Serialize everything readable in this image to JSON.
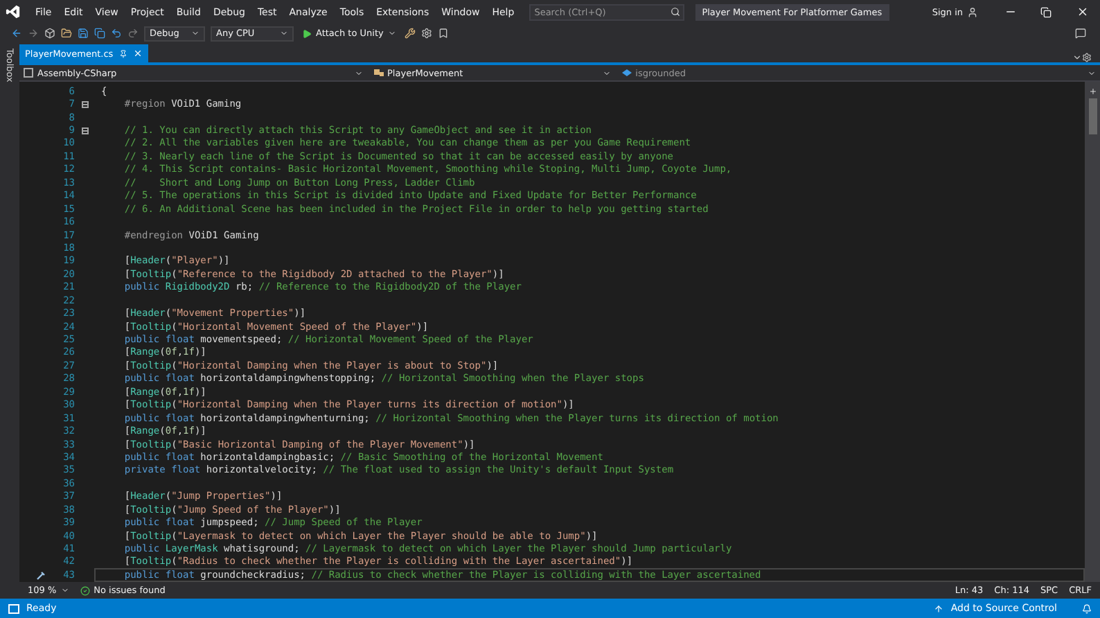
{
  "window": {
    "title": "Player Movement For Platformer Games",
    "sign_in": "Sign in"
  },
  "menu": [
    "File",
    "Edit",
    "View",
    "Project",
    "Build",
    "Debug",
    "Test",
    "Analyze",
    "Tools",
    "Extensions",
    "Window",
    "Help"
  ],
  "search": {
    "placeholder": "Search (Ctrl+Q)"
  },
  "toolbar": {
    "configuration": "Debug",
    "platform": "Any CPU",
    "run": "Attach to Unity"
  },
  "side_panel": {
    "label": "Toolbox"
  },
  "tabs": [
    {
      "label": "PlayerMovement.cs",
      "selected": true
    }
  ],
  "navigation": {
    "project": "Assembly-CSharp",
    "type": "PlayerMovement",
    "member": "isgrounded"
  },
  "editor": {
    "lines": [
      {
        "number": "6",
        "fold": false,
        "current": false,
        "tokens": [
          {
            "kind": "plain",
            "text": "{"
          }
        ]
      },
      {
        "number": "7",
        "fold": true,
        "current": false,
        "tokens": [
          {
            "kind": "directive",
            "text": "    #region"
          },
          {
            "kind": "plain",
            "text": " VOiD1 Gaming"
          }
        ]
      },
      {
        "number": "8",
        "fold": false,
        "current": false
      },
      {
        "number": "9",
        "fold": true,
        "current": false,
        "tokens": [
          {
            "kind": "comment",
            "text": "    // 1. You can directly attach this Script to any GameObject and see it in action"
          }
        ]
      },
      {
        "number": "10",
        "fold": false,
        "current": false,
        "tokens": [
          {
            "kind": "comment",
            "text": "    // 2. All the variables given here are tweakable, You can change them as per you Game Requirement"
          }
        ]
      },
      {
        "number": "11",
        "fold": false,
        "current": false,
        "tokens": [
          {
            "kind": "comment",
            "text": "    // 3. Nearly each line of the Script is Documented so that it can be accessed easily by anyone"
          }
        ]
      },
      {
        "number": "12",
        "fold": false,
        "current": false,
        "tokens": [
          {
            "kind": "comment",
            "text": "    // 4. This Script contains- Basic Horizontal Movement, Smoothing while Stoping, Multi Jump, Coyote Jump,"
          }
        ]
      },
      {
        "number": "13",
        "fold": false,
        "current": false,
        "tokens": [
          {
            "kind": "comment",
            "text": "    //    Short and Long Jump on Button Long Press, Ladder Climb"
          }
        ]
      },
      {
        "number": "14",
        "fold": false,
        "current": false,
        "tokens": [
          {
            "kind": "comment",
            "text": "    // 5. The operations in this Script is divided into Update and Fixed Update for Better Performance"
          }
        ]
      },
      {
        "number": "15",
        "fold": false,
        "current": false,
        "tokens": [
          {
            "kind": "comment",
            "text": "    // 6. An Additional Scene has been included in the Project File in order to help you getting started"
          }
        ]
      },
      {
        "number": "16",
        "fold": false,
        "current": false
      },
      {
        "number": "17",
        "fold": false,
        "current": false,
        "tokens": [
          {
            "kind": "directive",
            "text": "    #endregion"
          },
          {
            "kind": "plain",
            "text": " VOiD1 Gaming"
          }
        ]
      },
      {
        "number": "18",
        "fold": false,
        "current": false
      },
      {
        "number": "19",
        "fold": false,
        "current": false,
        "tokens": [
          {
            "kind": "plain",
            "text": "    ["
          },
          {
            "kind": "type",
            "text": "Header"
          },
          {
            "kind": "plain",
            "text": "("
          },
          {
            "kind": "string",
            "text": "\"Player\""
          },
          {
            "kind": "plain",
            "text": ")]"
          }
        ]
      },
      {
        "number": "20",
        "fold": false,
        "current": false,
        "tokens": [
          {
            "kind": "plain",
            "text": "    ["
          },
          {
            "kind": "type",
            "text": "Tooltip"
          },
          {
            "kind": "plain",
            "text": "("
          },
          {
            "kind": "string",
            "text": "\"Reference to the Rigidbody 2D attached to the Player\""
          },
          {
            "kind": "plain",
            "text": ")]"
          }
        ]
      },
      {
        "number": "21",
        "fold": false,
        "current": false,
        "tokens": [
          {
            "kind": "keyword",
            "text": "    public"
          },
          {
            "kind": "type",
            "text": " Rigidbody2D"
          },
          {
            "kind": "plain",
            "text": " rb; "
          },
          {
            "kind": "comment",
            "text": "// Reference to the Rigidbody2D of the Player"
          }
        ]
      },
      {
        "number": "22",
        "fold": false,
        "current": false
      },
      {
        "number": "23",
        "fold": false,
        "current": false,
        "tokens": [
          {
            "kind": "plain",
            "text": "    ["
          },
          {
            "kind": "type",
            "text": "Header"
          },
          {
            "kind": "plain",
            "text": "("
          },
          {
            "kind": "string",
            "text": "\"Movement Properties\""
          },
          {
            "kind": "plain",
            "text": ")]"
          }
        ]
      },
      {
        "number": "24",
        "fold": false,
        "current": false,
        "tokens": [
          {
            "kind": "plain",
            "text": "    ["
          },
          {
            "kind": "type",
            "text": "Tooltip"
          },
          {
            "kind": "plain",
            "text": "("
          },
          {
            "kind": "string",
            "text": "\"Horizontal Movement Speed of the Player\""
          },
          {
            "kind": "plain",
            "text": ")]"
          }
        ]
      },
      {
        "number": "25",
        "fold": false,
        "current": false,
        "tokens": [
          {
            "kind": "keyword",
            "text": "    public float"
          },
          {
            "kind": "plain",
            "text": " movementspeed; "
          },
          {
            "kind": "comment",
            "text": "// Horizontal Movement Speed of the Player"
          }
        ]
      },
      {
        "number": "26",
        "fold": false,
        "current": false,
        "tokens": [
          {
            "kind": "plain",
            "text": "    ["
          },
          {
            "kind": "type",
            "text": "Range"
          },
          {
            "kind": "plain",
            "text": "("
          },
          {
            "kind": "number",
            "text": "0f"
          },
          {
            "kind": "plain",
            "text": ","
          },
          {
            "kind": "number",
            "text": "1f"
          },
          {
            "kind": "plain",
            "text": ")]"
          }
        ]
      },
      {
        "number": "27",
        "fold": false,
        "current": false,
        "tokens": [
          {
            "kind": "plain",
            "text": "    ["
          },
          {
            "kind": "type",
            "text": "Tooltip"
          },
          {
            "kind": "plain",
            "text": "("
          },
          {
            "kind": "string",
            "text": "\"Horizontal Damping when the Player is about to Stop\""
          },
          {
            "kind": "plain",
            "text": ")]"
          }
        ]
      },
      {
        "number": "28",
        "fold": false,
        "current": false,
        "tokens": [
          {
            "kind": "keyword",
            "text": "    public float"
          },
          {
            "kind": "plain",
            "text": " horizontaldampingwhenstopping; "
          },
          {
            "kind": "comment",
            "text": "// Horizontal Smoothing when the Player stops"
          }
        ]
      },
      {
        "number": "29",
        "fold": false,
        "current": false,
        "tokens": [
          {
            "kind": "plain",
            "text": "    ["
          },
          {
            "kind": "type",
            "text": "Range"
          },
          {
            "kind": "plain",
            "text": "("
          },
          {
            "kind": "number",
            "text": "0f"
          },
          {
            "kind": "plain",
            "text": ","
          },
          {
            "kind": "number",
            "text": "1f"
          },
          {
            "kind": "plain",
            "text": ")]"
          }
        ]
      },
      {
        "number": "30",
        "fold": false,
        "current": false,
        "tokens": [
          {
            "kind": "plain",
            "text": "    ["
          },
          {
            "kind": "type",
            "text": "Tooltip"
          },
          {
            "kind": "plain",
            "text": "("
          },
          {
            "kind": "string",
            "text": "\"Horizontal Damping when the Player turns its direction of motion\""
          },
          {
            "kind": "plain",
            "text": ")]"
          }
        ]
      },
      {
        "number": "31",
        "fold": false,
        "current": false,
        "tokens": [
          {
            "kind": "keyword",
            "text": "    public float"
          },
          {
            "kind": "plain",
            "text": " horizontaldampingwhenturning; "
          },
          {
            "kind": "comment",
            "text": "// Horizontal Smoothing when the Player turns its direction of motion"
          }
        ]
      },
      {
        "number": "32",
        "fold": false,
        "current": false,
        "tokens": [
          {
            "kind": "plain",
            "text": "    ["
          },
          {
            "kind": "type",
            "text": "Range"
          },
          {
            "kind": "plain",
            "text": "("
          },
          {
            "kind": "number",
            "text": "0f"
          },
          {
            "kind": "plain",
            "text": ","
          },
          {
            "kind": "number",
            "text": "1f"
          },
          {
            "kind": "plain",
            "text": ")]"
          }
        ]
      },
      {
        "number": "33",
        "fold": false,
        "current": false,
        "tokens": [
          {
            "kind": "plain",
            "text": "    ["
          },
          {
            "kind": "type",
            "text": "Tooltip"
          },
          {
            "kind": "plain",
            "text": "("
          },
          {
            "kind": "string",
            "text": "\"Basic Horizontal Damping of the Player Movement\""
          },
          {
            "kind": "plain",
            "text": ")]"
          }
        ]
      },
      {
        "number": "34",
        "fold": false,
        "current": false,
        "tokens": [
          {
            "kind": "keyword",
            "text": "    public float"
          },
          {
            "kind": "plain",
            "text": " horizontaldampingbasic; "
          },
          {
            "kind": "comment",
            "text": "// Basic Smoothing of the Horizontal Movement"
          }
        ]
      },
      {
        "number": "35",
        "fold": false,
        "current": false,
        "tokens": [
          {
            "kind": "keyword",
            "text": "    private float"
          },
          {
            "kind": "plain",
            "text": " horizontalvelocity; "
          },
          {
            "kind": "comment",
            "text": "// The float used to assign the Unity's default Input System"
          }
        ]
      },
      {
        "number": "36",
        "fold": false,
        "current": false
      },
      {
        "number": "37",
        "fold": false,
        "current": false,
        "tokens": [
          {
            "kind": "plain",
            "text": "    ["
          },
          {
            "kind": "type",
            "text": "Header"
          },
          {
            "kind": "plain",
            "text": "("
          },
          {
            "kind": "string",
            "text": "\"Jump Properties\""
          },
          {
            "kind": "plain",
            "text": ")]"
          }
        ]
      },
      {
        "number": "38",
        "fold": false,
        "current": false,
        "tokens": [
          {
            "kind": "plain",
            "text": "    ["
          },
          {
            "kind": "type",
            "text": "Tooltip"
          },
          {
            "kind": "plain",
            "text": "("
          },
          {
            "kind": "string",
            "text": "\"Jump Speed of the Player\""
          },
          {
            "kind": "plain",
            "text": ")]"
          }
        ]
      },
      {
        "number": "39",
        "fold": false,
        "current": false,
        "tokens": [
          {
            "kind": "keyword",
            "text": "    public float"
          },
          {
            "kind": "plain",
            "text": " jumpspeed; "
          },
          {
            "kind": "comment",
            "text": "// Jump Speed of the Player"
          }
        ]
      },
      {
        "number": "40",
        "fold": false,
        "current": false,
        "tokens": [
          {
            "kind": "plain",
            "text": "    ["
          },
          {
            "kind": "type",
            "text": "Tooltip"
          },
          {
            "kind": "plain",
            "text": "("
          },
          {
            "kind": "string",
            "text": "\"Layermask to detect on which Layer the Player should be able to Jump\""
          },
          {
            "kind": "plain",
            "text": ")]"
          }
        ]
      },
      {
        "number": "41",
        "fold": false,
        "current": false,
        "tokens": [
          {
            "kind": "keyword",
            "text": "    public"
          },
          {
            "kind": "type",
            "text": " LayerMask"
          },
          {
            "kind": "plain",
            "text": " whatisground; "
          },
          {
            "kind": "comment",
            "text": "// Layermask to detect on which Layer the Player should Jump particularly"
          }
        ]
      },
      {
        "number": "42",
        "fold": false,
        "current": false,
        "tokens": [
          {
            "kind": "plain",
            "text": "    ["
          },
          {
            "kind": "type",
            "text": "Tooltip"
          },
          {
            "kind": "plain",
            "text": "("
          },
          {
            "kind": "string",
            "text": "\"Radius to check whether the Player is colliding with the Layer ascertained\""
          },
          {
            "kind": "plain",
            "text": ")]"
          }
        ]
      },
      {
        "number": "43",
        "fold": false,
        "current": true,
        "tokens": [
          {
            "kind": "keyword",
            "text": "    public float"
          },
          {
            "kind": "plain",
            "text": " groundcheckradius; "
          },
          {
            "kind": "comment",
            "text": "// Radius to check whether the Player is colliding with the Layer ascertained"
          }
        ]
      }
    ]
  },
  "editor_status": {
    "zoom": "109 %",
    "issues": "No issues found",
    "line": "Ln: 43",
    "column": "Ch: 114",
    "indent": "SPC",
    "line_ending": "CRLF"
  },
  "status_bar": {
    "state": "Ready",
    "source_control": "Add to Source Control"
  }
}
